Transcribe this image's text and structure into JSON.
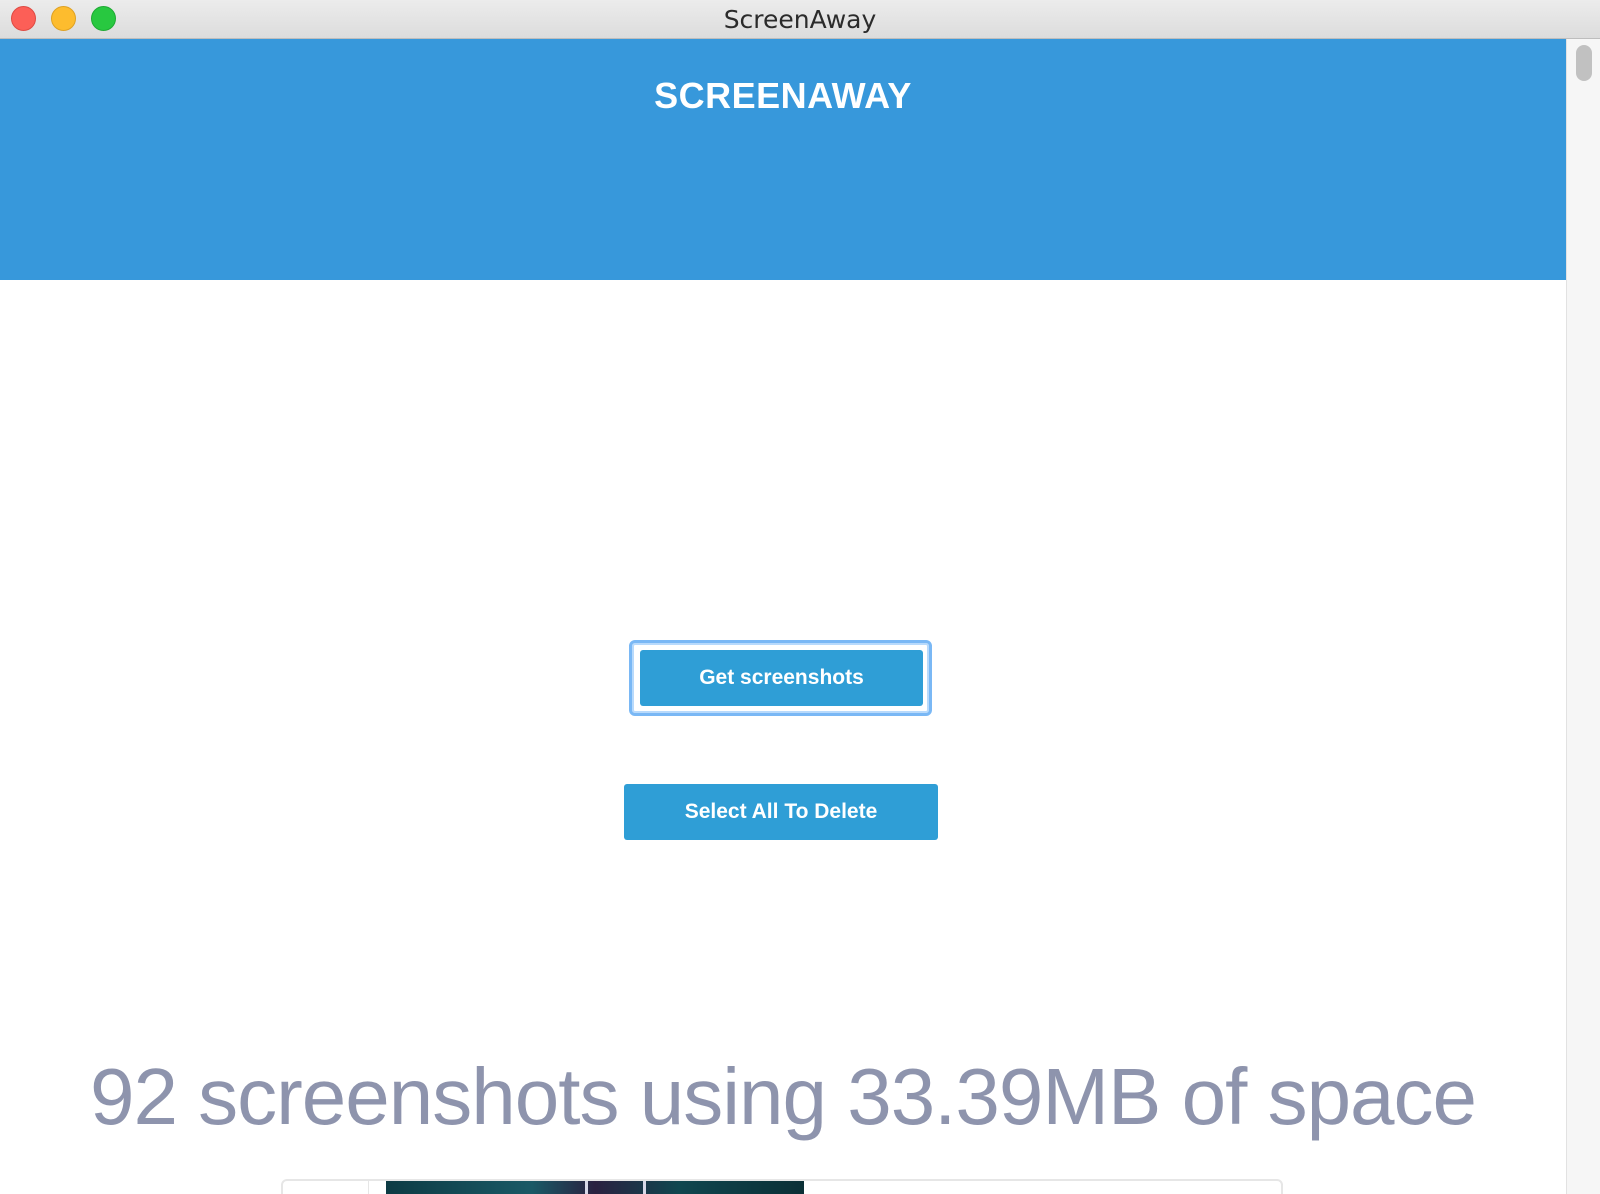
{
  "window": {
    "title": "ScreenAway"
  },
  "header": {
    "brand": "SCREENAWAY",
    "background_color": "#3798db"
  },
  "actions": {
    "get_screenshots_label": "Get screenshots",
    "select_all_label": "Select All To Delete",
    "button_color": "#2f9ed6"
  },
  "summary": {
    "text": "92 screenshots using 33.39MB of space",
    "screenshot_count": 92,
    "space_used": "33.39MB"
  },
  "icons": {
    "close": "close-icon",
    "minimize": "minimize-icon",
    "zoom": "zoom-icon"
  }
}
